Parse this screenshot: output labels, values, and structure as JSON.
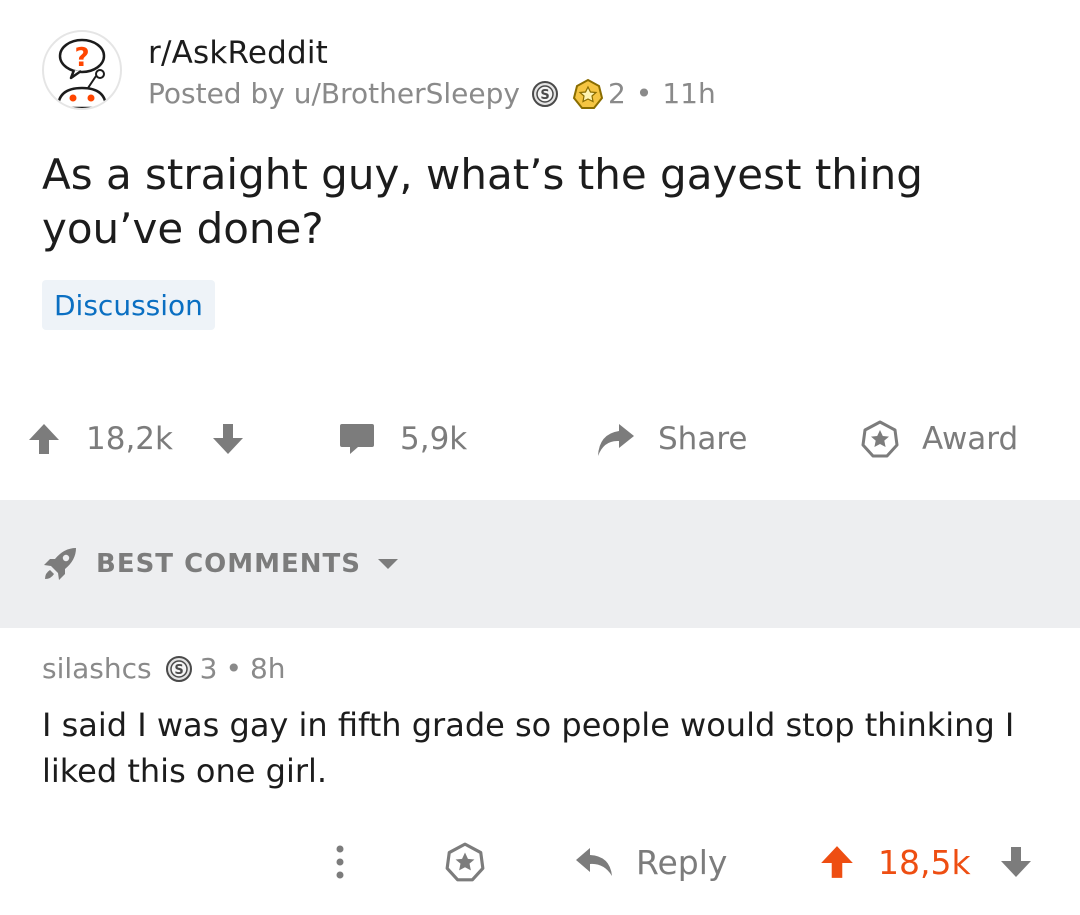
{
  "post": {
    "subreddit": "r/AskReddit",
    "posted_by_prefix": "Posted by ",
    "username": "u/BrotherSleepy",
    "award_count": "2",
    "separator": "•",
    "time_ago": "11h",
    "title": "As a straight guy, what’s the gayest thing you’ve done?",
    "flair": "Discussion",
    "upvotes": "18,2k",
    "comments": "5,9k",
    "share_label": "Share",
    "award_label": "Award"
  },
  "sort": {
    "label": "BEST COMMENTS"
  },
  "comment": {
    "author": "silashcs",
    "award_count": "3",
    "separator": "•",
    "time_ago": "8h",
    "body": "I said I was gay in fifth grade so people would stop thinking I liked this one girl.",
    "reply_label": "Reply",
    "score": "18,5k"
  },
  "colors": {
    "upvote_active": "#ee4e12",
    "flair_text": "#0a6fc2",
    "flair_bg": "#eef3f8",
    "meta_grey": "#8a8a8a",
    "sort_band": "#edeef0"
  },
  "icons": {
    "subreddit_avatar": "askreddit-snoo-icon",
    "silver_award": "silver-award-icon",
    "gold_award": "gold-award-icon",
    "upvote": "arrow-up-icon",
    "downvote": "arrow-down-icon",
    "comments": "comment-bubble-icon",
    "share": "share-arrow-icon",
    "award": "award-icon",
    "sort": "rocket-icon",
    "more": "more-vertical-icon",
    "reply": "reply-arrow-icon"
  }
}
